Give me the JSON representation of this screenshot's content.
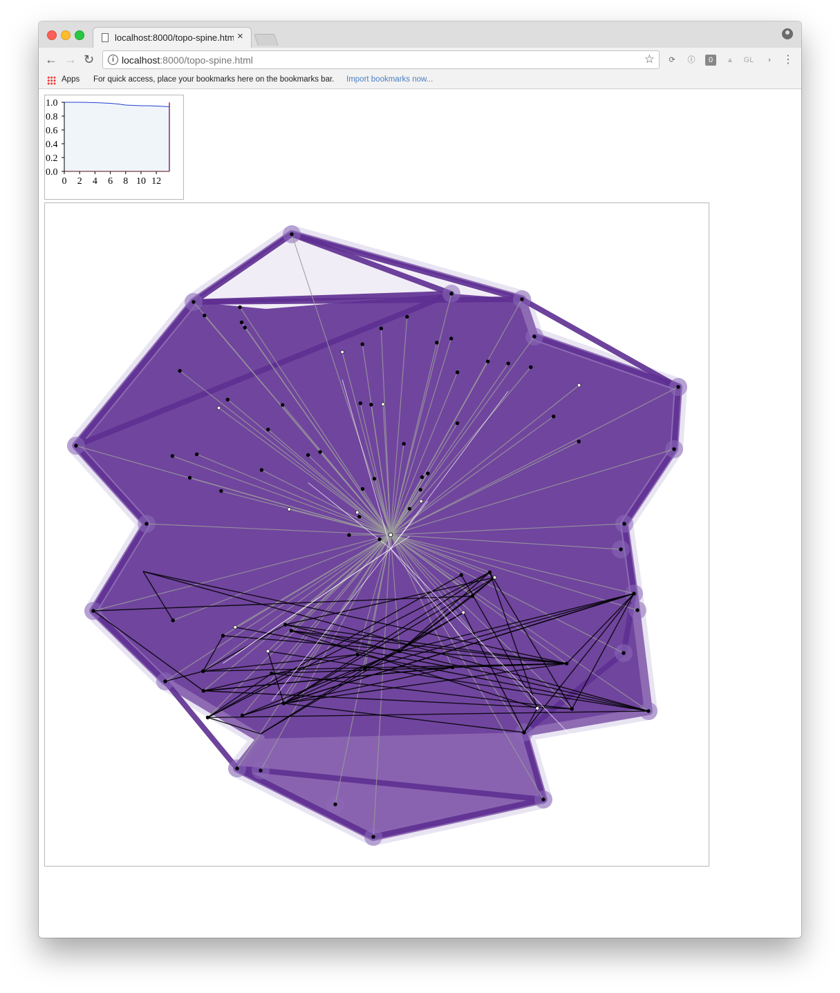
{
  "browser": {
    "tab_title": "localhost:8000/topo-spine.html",
    "tab_close": "×",
    "url_host": "localhost",
    "url_rest": ":8000/topo-spine.html",
    "nav_back": "←",
    "nav_forward": "→",
    "nav_reload": "↻",
    "star": "☆",
    "extensions": [
      "sync-icon",
      "info-icon",
      "zero-icon",
      "drive-icon",
      "gl-icon",
      "globe-icon",
      "menu-icon"
    ],
    "ext_glyphs": [
      "⟳",
      "ⓘ",
      "0",
      "▲",
      "GL",
      "◑",
      "⋮"
    ]
  },
  "bookmarks_bar": {
    "apps_label": "Apps",
    "hint": "For quick access, place your bookmarks here on the bookmarks bar.",
    "import_link": "Import bookmarks now..."
  },
  "colors": {
    "hull": "#6a3d9a",
    "hull_light": "#8a65b0",
    "halo": "#e8e4f2",
    "spoke": "#9a9a9a",
    "dark_edge": "#000000",
    "mini_fill": "#f0f5fa",
    "mini_line": "#1f3fd0",
    "mini_marker": "#e0203c"
  },
  "chart_data": {
    "type": "area",
    "x_ticks": [
      "0",
      "2",
      "4",
      "6",
      "8",
      "10",
      "12"
    ],
    "y_ticks": [
      "1.0",
      "0.8",
      "0.6",
      "0.4",
      "0.2",
      "0.0"
    ],
    "xlim": [
      0,
      13.7
    ],
    "ylim": [
      0,
      1
    ],
    "series": [
      {
        "x": [
          0,
          2,
          4,
          5,
          6,
          7,
          8,
          9,
          10,
          11,
          12,
          13,
          13.7
        ],
        "values": [
          1.0,
          1.0,
          0.995,
          0.99,
          0.985,
          0.975,
          0.96,
          0.955,
          0.95,
          0.95,
          0.945,
          0.94,
          0.935
        ]
      }
    ],
    "marker_x": 13.7
  }
}
